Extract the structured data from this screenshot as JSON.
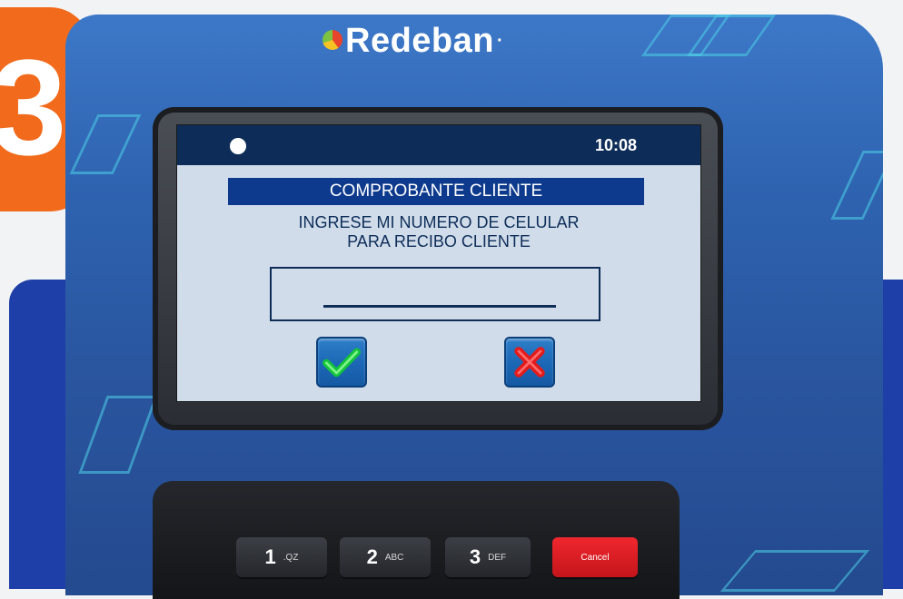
{
  "step": {
    "number": "3"
  },
  "brand": {
    "name": "Redeban",
    "mark": "·"
  },
  "screen": {
    "time": "10:08",
    "title": "COMPROBANTE CLIENTE",
    "prompt_line1": "INGRESE MI NUMERO DE CELULAR",
    "prompt_line2": "PARA RECIBO CLIENTE",
    "phone_input": {
      "value": ""
    },
    "confirm_icon": "checkmark-icon",
    "cancel_icon": "x-mark-icon"
  },
  "keypad": [
    {
      "digit": "1",
      "letters": ".QZ"
    },
    {
      "digit": "2",
      "letters": "ABC"
    },
    {
      "digit": "3",
      "letters": "DEF"
    },
    {
      "digit": "",
      "letters": "Cancel"
    }
  ],
  "colors": {
    "badge": "#f26a1b",
    "terminal": "#2e63b0",
    "status_bar": "#0d2d58",
    "title_bar": "#0d3a8d",
    "screen_bg": "#d1dcea",
    "cancel_key": "#e41e26"
  }
}
